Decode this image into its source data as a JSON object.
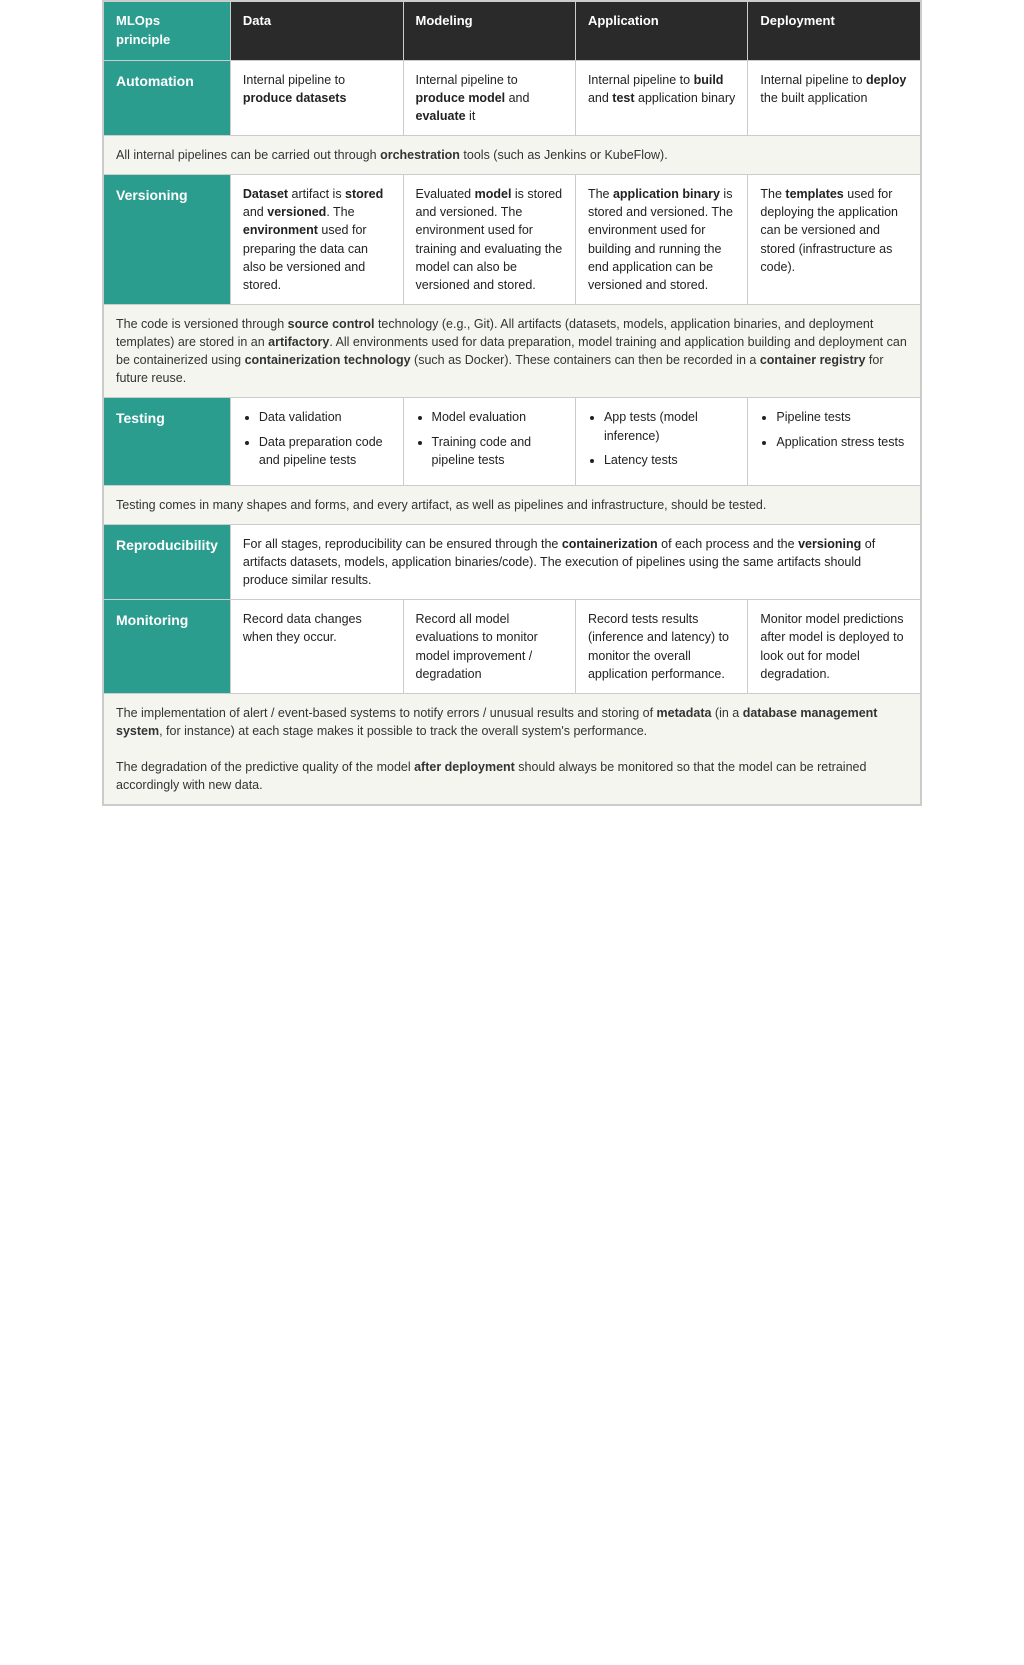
{
  "header": {
    "principle": "MLOps\nprinciple",
    "data": "Data",
    "modeling": "Modeling",
    "application": "Application",
    "deployment": "Deployment"
  },
  "rows": {
    "automation": {
      "principle": "Automation",
      "data": "Internal pipeline to <b>produce datasets</b>",
      "modeling": "Internal pipeline to <b>produce model</b> and <b>evaluate</b> it",
      "application": "Internal pipeline to <b>build</b> and <b>test</b> application binary",
      "deployment": "Internal pipeline to <b>deploy</b> the built application",
      "span": "All internal pipelines can be carried out through <b>orchestration</b> tools (such as Jenkins or KubeFlow)."
    },
    "versioning": {
      "principle": "Versioning",
      "data": "<b>Dataset</b> artifact is <b>stored</b> and <b>versioned</b>. The <b>environment</b> used for preparing the data can also be versioned and stored.",
      "modeling": "Evaluated <b>model</b> is stored and versioned. The environment used for training and evaluating the model can also be versioned and stored.",
      "application": "The <b>application binary</b> is stored and versioned. The environment used for building and running the end application can be versioned and stored.",
      "deployment": "The <b>templates</b> used for deploying the application can be versioned and stored (infrastructure as code).",
      "span": "The code is versioned through <b>source control</b> technology (e.g., Git). All artifacts (datasets, models, application binaries, and deployment templates) are stored in an <b>artifactory</b>. All environments used for data preparation, model training and application building and deployment can be containerized using <b>containerization technology</b> (such as Docker). These containers can then be recorded in a <b>container registry</b> for future reuse."
    },
    "testing": {
      "principle": "Testing",
      "data_list": [
        "Data validation",
        "Data preparation code and pipeline tests"
      ],
      "modeling_list": [
        "Model evaluation",
        "Training code and pipeline tests"
      ],
      "application_list": [
        "App tests (model inference)",
        "Latency tests"
      ],
      "deployment_list": [
        "Pipeline tests",
        "Application stress tests"
      ],
      "span": "Testing comes in many shapes and forms, and every artifact, as well as pipelines and infrastructure, should be tested."
    },
    "reproducibility": {
      "principle": "Reproducibility",
      "span": "For all stages, reproducibility can be ensured through the <b>containerization</b> of each process and the <b>versioning</b> of artifacts datasets, models, application binaries/code). The execution of pipelines using the same artifacts should produce similar results."
    },
    "monitoring": {
      "principle": "Monitoring",
      "data": "Record data changes when they occur.",
      "modeling": "Record all model evaluations to monitor model improvement / degradation",
      "application": "Record tests results (inference and latency) to monitor the overall application performance.",
      "deployment": "Monitor model predictions after model is deployed to look out for model degradation.",
      "span1": "The implementation of alert / event-based systems to notify errors / unusual results and storing of <b>metadata</b> (in a <b>database management system</b>, for instance) at each stage makes it possible to track the overall system's performance.",
      "span2": "The degradation of the predictive quality of the model <b>after deployment</b> should always be monitored so that the model can be retrained accordingly with new data."
    }
  }
}
